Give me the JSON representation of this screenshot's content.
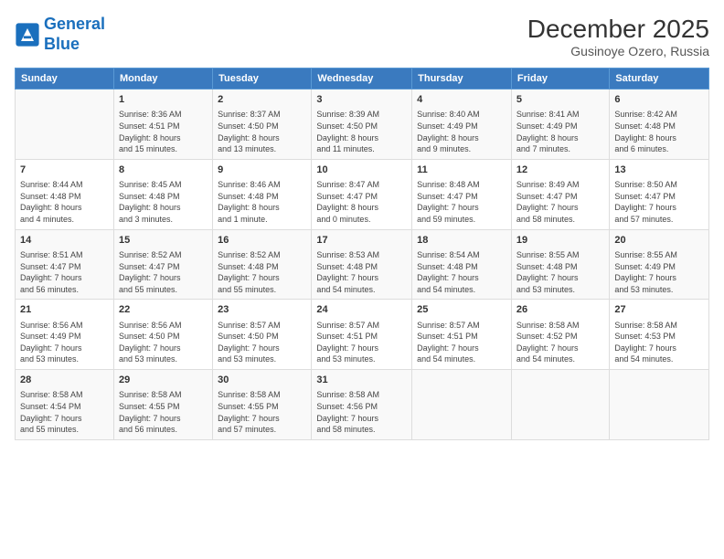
{
  "logo": {
    "line1": "General",
    "line2": "Blue"
  },
  "title": "December 2025",
  "location": "Gusinoye Ozero, Russia",
  "days_of_week": [
    "Sunday",
    "Monday",
    "Tuesday",
    "Wednesday",
    "Thursday",
    "Friday",
    "Saturday"
  ],
  "weeks": [
    [
      {
        "day": "",
        "info": ""
      },
      {
        "day": "1",
        "info": "Sunrise: 8:36 AM\nSunset: 4:51 PM\nDaylight: 8 hours\nand 15 minutes."
      },
      {
        "day": "2",
        "info": "Sunrise: 8:37 AM\nSunset: 4:50 PM\nDaylight: 8 hours\nand 13 minutes."
      },
      {
        "day": "3",
        "info": "Sunrise: 8:39 AM\nSunset: 4:50 PM\nDaylight: 8 hours\nand 11 minutes."
      },
      {
        "day": "4",
        "info": "Sunrise: 8:40 AM\nSunset: 4:49 PM\nDaylight: 8 hours\nand 9 minutes."
      },
      {
        "day": "5",
        "info": "Sunrise: 8:41 AM\nSunset: 4:49 PM\nDaylight: 8 hours\nand 7 minutes."
      },
      {
        "day": "6",
        "info": "Sunrise: 8:42 AM\nSunset: 4:48 PM\nDaylight: 8 hours\nand 6 minutes."
      }
    ],
    [
      {
        "day": "7",
        "info": "Sunrise: 8:44 AM\nSunset: 4:48 PM\nDaylight: 8 hours\nand 4 minutes."
      },
      {
        "day": "8",
        "info": "Sunrise: 8:45 AM\nSunset: 4:48 PM\nDaylight: 8 hours\nand 3 minutes."
      },
      {
        "day": "9",
        "info": "Sunrise: 8:46 AM\nSunset: 4:48 PM\nDaylight: 8 hours\nand 1 minute."
      },
      {
        "day": "10",
        "info": "Sunrise: 8:47 AM\nSunset: 4:47 PM\nDaylight: 8 hours\nand 0 minutes."
      },
      {
        "day": "11",
        "info": "Sunrise: 8:48 AM\nSunset: 4:47 PM\nDaylight: 7 hours\nand 59 minutes."
      },
      {
        "day": "12",
        "info": "Sunrise: 8:49 AM\nSunset: 4:47 PM\nDaylight: 7 hours\nand 58 minutes."
      },
      {
        "day": "13",
        "info": "Sunrise: 8:50 AM\nSunset: 4:47 PM\nDaylight: 7 hours\nand 57 minutes."
      }
    ],
    [
      {
        "day": "14",
        "info": "Sunrise: 8:51 AM\nSunset: 4:47 PM\nDaylight: 7 hours\nand 56 minutes."
      },
      {
        "day": "15",
        "info": "Sunrise: 8:52 AM\nSunset: 4:47 PM\nDaylight: 7 hours\nand 55 minutes."
      },
      {
        "day": "16",
        "info": "Sunrise: 8:52 AM\nSunset: 4:48 PM\nDaylight: 7 hours\nand 55 minutes."
      },
      {
        "day": "17",
        "info": "Sunrise: 8:53 AM\nSunset: 4:48 PM\nDaylight: 7 hours\nand 54 minutes."
      },
      {
        "day": "18",
        "info": "Sunrise: 8:54 AM\nSunset: 4:48 PM\nDaylight: 7 hours\nand 54 minutes."
      },
      {
        "day": "19",
        "info": "Sunrise: 8:55 AM\nSunset: 4:48 PM\nDaylight: 7 hours\nand 53 minutes."
      },
      {
        "day": "20",
        "info": "Sunrise: 8:55 AM\nSunset: 4:49 PM\nDaylight: 7 hours\nand 53 minutes."
      }
    ],
    [
      {
        "day": "21",
        "info": "Sunrise: 8:56 AM\nSunset: 4:49 PM\nDaylight: 7 hours\nand 53 minutes."
      },
      {
        "day": "22",
        "info": "Sunrise: 8:56 AM\nSunset: 4:50 PM\nDaylight: 7 hours\nand 53 minutes."
      },
      {
        "day": "23",
        "info": "Sunrise: 8:57 AM\nSunset: 4:50 PM\nDaylight: 7 hours\nand 53 minutes."
      },
      {
        "day": "24",
        "info": "Sunrise: 8:57 AM\nSunset: 4:51 PM\nDaylight: 7 hours\nand 53 minutes."
      },
      {
        "day": "25",
        "info": "Sunrise: 8:57 AM\nSunset: 4:51 PM\nDaylight: 7 hours\nand 54 minutes."
      },
      {
        "day": "26",
        "info": "Sunrise: 8:58 AM\nSunset: 4:52 PM\nDaylight: 7 hours\nand 54 minutes."
      },
      {
        "day": "27",
        "info": "Sunrise: 8:58 AM\nSunset: 4:53 PM\nDaylight: 7 hours\nand 54 minutes."
      }
    ],
    [
      {
        "day": "28",
        "info": "Sunrise: 8:58 AM\nSunset: 4:54 PM\nDaylight: 7 hours\nand 55 minutes."
      },
      {
        "day": "29",
        "info": "Sunrise: 8:58 AM\nSunset: 4:55 PM\nDaylight: 7 hours\nand 56 minutes."
      },
      {
        "day": "30",
        "info": "Sunrise: 8:58 AM\nSunset: 4:55 PM\nDaylight: 7 hours\nand 57 minutes."
      },
      {
        "day": "31",
        "info": "Sunrise: 8:58 AM\nSunset: 4:56 PM\nDaylight: 7 hours\nand 58 minutes."
      },
      {
        "day": "",
        "info": ""
      },
      {
        "day": "",
        "info": ""
      },
      {
        "day": "",
        "info": ""
      }
    ]
  ]
}
